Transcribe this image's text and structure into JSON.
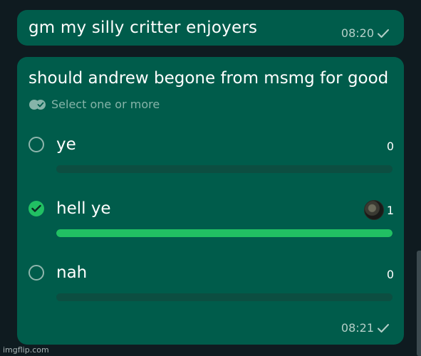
{
  "messages": [
    {
      "text": "gm my silly critter enjoyers",
      "time": "08:20"
    }
  ],
  "poll": {
    "question": "should andrew begone from msmg for good",
    "hint": "Select one or more",
    "time": "08:21",
    "options": [
      {
        "label": "ye",
        "votes": "0",
        "selected": false,
        "fill_fraction": 0
      },
      {
        "label": "hell ye",
        "votes": "1",
        "selected": true,
        "fill_fraction": 1
      },
      {
        "label": "nah",
        "votes": "0",
        "selected": false,
        "fill_fraction": 0
      }
    ]
  },
  "icons": {
    "tick": "check-icon",
    "multi_select": "double-check-icon",
    "voter": "avatar"
  },
  "colors": {
    "bubble": "#005c4b",
    "accent": "#21c063",
    "track": "#0c4e41"
  },
  "watermark": "imgflip.com"
}
